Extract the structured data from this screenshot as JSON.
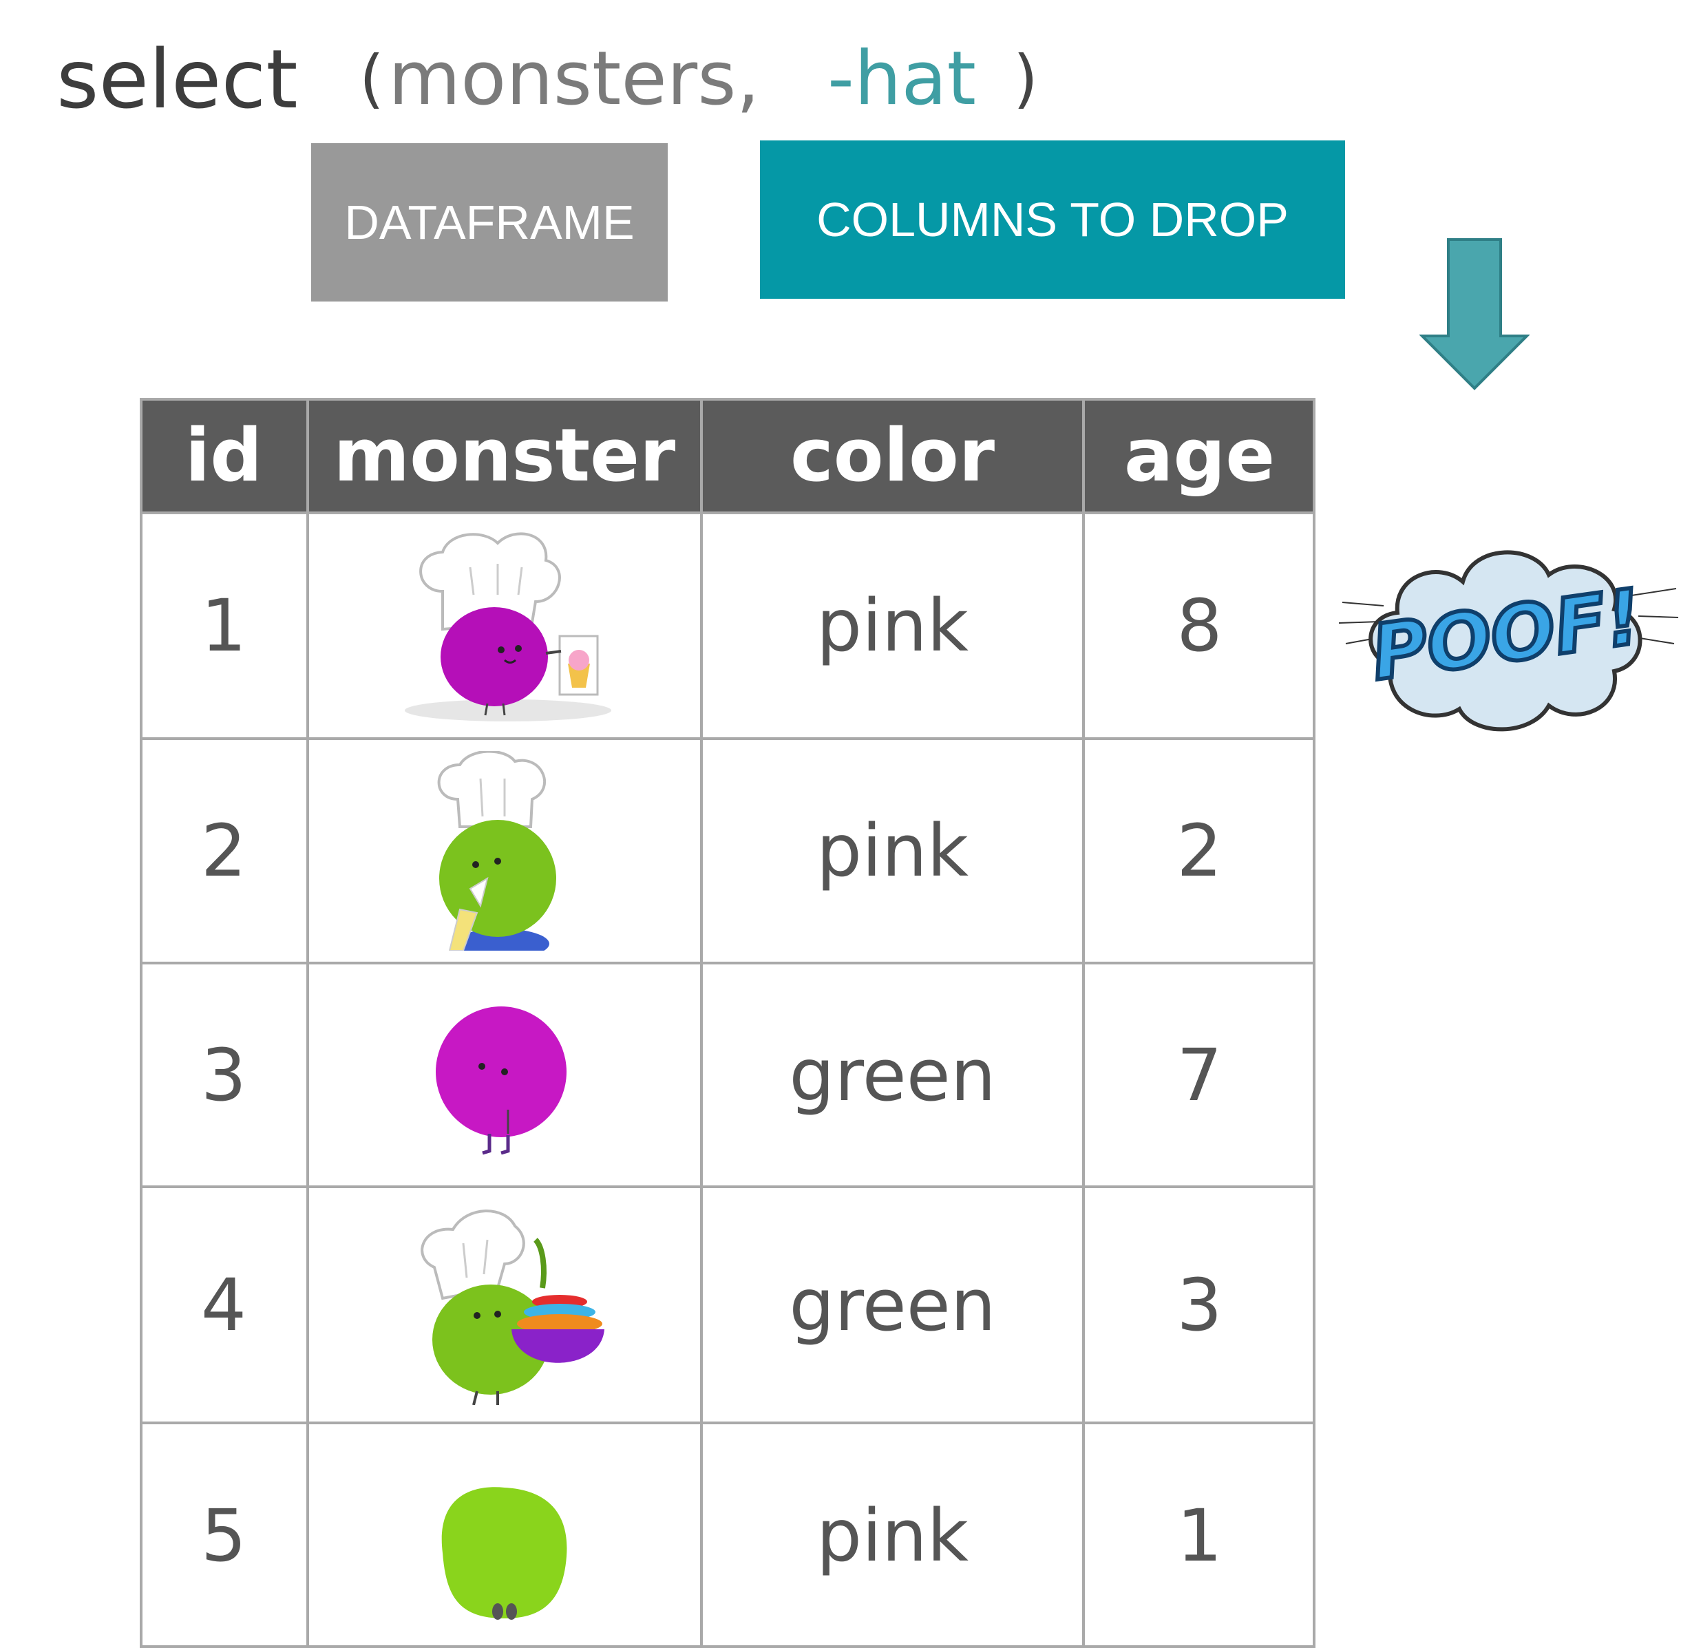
{
  "code": {
    "function": "select",
    "open_paren": "(",
    "dataframe_arg": "monsters,",
    "drop_arg": "-hat",
    "close_paren": ")"
  },
  "labels": {
    "dataframe": "DATAFRAME",
    "columns_to_drop": "COLUMNS TO DROP"
  },
  "colors": {
    "dataframe_box": "#999999",
    "drop_box": "#0598a6",
    "arrow": "#4aa6ad",
    "header_bg": "#5b5b5b"
  },
  "table": {
    "headers": [
      "id",
      "monster",
      "color",
      "age"
    ],
    "rows": [
      {
        "id": "1",
        "monster": "purple-chef-monster-with-cupcake",
        "color": "pink",
        "age": "8"
      },
      {
        "id": "2",
        "monster": "green-chef-monster-with-piping-bag",
        "color": "pink",
        "age": "2"
      },
      {
        "id": "3",
        "monster": "purple-monster",
        "color": "green",
        "age": "7"
      },
      {
        "id": "4",
        "monster": "green-chef-monster-with-bowls",
        "color": "green",
        "age": "3"
      },
      {
        "id": "5",
        "monster": "green-monster",
        "color": "pink",
        "age": "1"
      }
    ]
  },
  "poof": {
    "text": "POOF!",
    "icon": "poof-cloud-icon"
  },
  "arrow_icon": "arrow-down-icon"
}
